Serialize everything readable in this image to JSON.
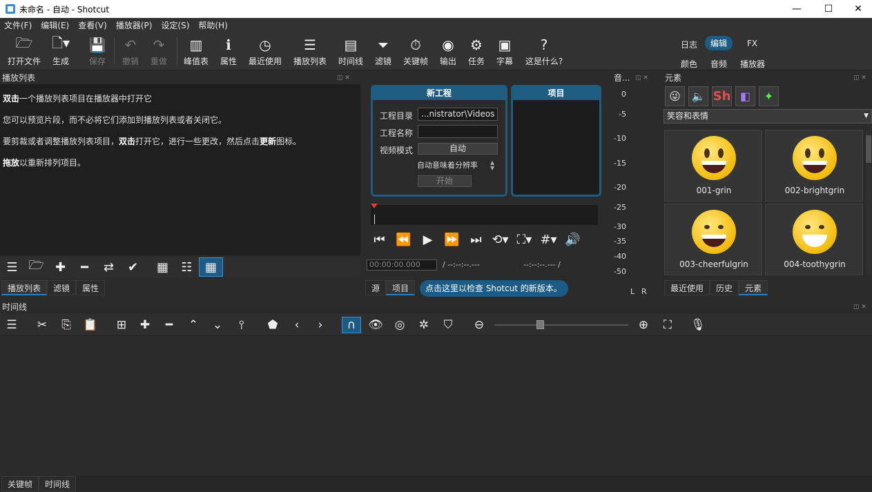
{
  "window": {
    "title": "未命名 - 自动 - Shotcut",
    "minimize": "—",
    "maximize": "☐",
    "close": "✕"
  },
  "menu": [
    "文件(F)",
    "编辑(E)",
    "查看(V)",
    "播放器(P)",
    "设定(S)",
    "帮助(H)"
  ],
  "toolbar": {
    "open": "打开文件",
    "generate": "生成",
    "save": "保存",
    "undo": "撤销",
    "redo": "重做",
    "peak": "峰值表",
    "properties": "属性",
    "recent": "最近使用",
    "playlist": "播放列表",
    "timeline": "时间线",
    "filters": "滤镜",
    "keyframes": "关键帧",
    "export": "输出",
    "jobs": "任务",
    "subtitles": "字幕",
    "whatsthis": "这是什么?"
  },
  "modes": {
    "logs": "日志",
    "edit": "编辑",
    "fx": "FX",
    "color": "颜色",
    "audio": "音频",
    "player": "播放器"
  },
  "playlist": {
    "header": "播放列表",
    "lines": [
      {
        "bold": "双击",
        "rest": "一个播放列表项目在播放器中打开它"
      },
      {
        "text": "您可以预览片段，而不必将它们添加到播放列表或者关闭它。"
      },
      {
        "pre": "要剪裁或者调整播放列表项目，",
        "bold": "双击",
        "mid": "打开它，进行一些更改，然后点击",
        "bold2": "更新",
        "post": "图标。"
      },
      {
        "bold": "拖放",
        "rest": "以重新排列项目。"
      }
    ],
    "tabs": [
      "播放列表",
      "滤镜",
      "属性"
    ]
  },
  "project": {
    "new_title": "新工程",
    "projects_title": "项目",
    "dir_label": "工程目录",
    "dir_value": "...nistrator\\Videos",
    "name_label": "工程名称",
    "name_value": "",
    "mode_label": "视频模式",
    "mode_value": "自动",
    "hint": "自动意味着分辨率",
    "start": "开始"
  },
  "player": {
    "timecode": "00:00:00.000",
    "duration": "/ --:--:--.---",
    "in_out": "--:--:--.---  /",
    "tabs": [
      "源",
      "项目"
    ],
    "update_notice": "点击这里以检查 Shotcut 的新版本。"
  },
  "audio": {
    "header": "音...",
    "scale": [
      "0",
      "-5",
      "-10",
      "-15",
      "-20",
      "-25",
      "-30",
      "-35",
      "-40",
      "-50"
    ],
    "left": "L",
    "right": "R"
  },
  "elements": {
    "header": "元素",
    "category": "笑容和表情",
    "items": [
      "001-grin",
      "002-brightgrin",
      "003-cheerfulgrin",
      "004-toothygrin"
    ],
    "tabs": [
      "最近使用",
      "历史",
      "元素"
    ]
  },
  "timeline": {
    "header": "时间线"
  },
  "status_tabs": [
    "关键帧",
    "时间线"
  ]
}
